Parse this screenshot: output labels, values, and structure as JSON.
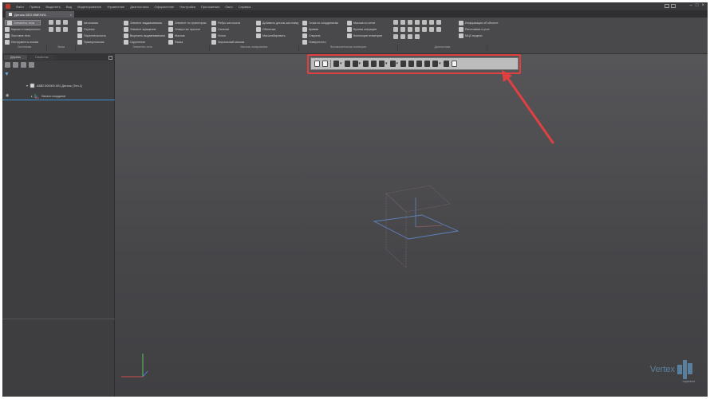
{
  "menu": {
    "items": [
      "Файл",
      "Правка",
      "Выделить",
      "Вид",
      "Моделирование",
      "Управление",
      "Диагностика",
      "Оформление",
      "Настройка",
      "Приложения",
      "Окно",
      "Справка"
    ]
  },
  "tabs": {
    "active_label": "Деталь БЕЗ ИМЕНИ1",
    "close": "×"
  },
  "window_controls": {
    "minimize": "–",
    "maximize": "□",
    "close": "×"
  },
  "ribbon": {
    "col1": [
      "Элементы тела",
      "Каркас и поверхности",
      "Листовое тело",
      "Инструменты эскиза"
    ],
    "col3": [
      "Автолиния",
      "Отрезок",
      "Параллельность",
      "Прямоугольник"
    ],
    "col4": [
      "Элемент выдавливания",
      "Элемент вращения",
      "Вырезать выдавливанием",
      "Скругление"
    ],
    "col5": [
      "Элемент по траектории",
      "Отверстие простое",
      "Массив",
      "Фаска"
    ],
    "col6": [
      "Ребро жесткости",
      "Сечение",
      "Уклон",
      "Зеркальный массив"
    ],
    "col7": [
      "Добавить деталь-заготовку",
      "Оболочка",
      "Масштабировать"
    ],
    "col8": [
      "Точка по координатам",
      "Кривая",
      "Спираль",
      "Поверхность"
    ],
    "col9": [
      "Массив по сетке",
      "Булева операция",
      "Коллекция геометрии"
    ],
    "col11": [
      "Информация об объекте",
      "Расстояние и угол",
      "МЦХ модели"
    ],
    "groups": [
      "Системная",
      "Эскиз",
      "Элементы тела",
      "Массив, копирование",
      "Вспомогательная геометрия",
      "Диагностика"
    ]
  },
  "panel": {
    "tab_tree": "Дерево",
    "tab_props": "Свойства",
    "root_label": "АБВГ.000000.001 Деталь (Тел-1)",
    "child_label": "Начало координат"
  },
  "brand": {
    "name": "Vertex",
    "sub": "подписка"
  },
  "colors": {
    "highlight": "#e04040",
    "arrow": "#e04040",
    "brand": "#6fb3e6",
    "tree_accent": "#3d8fd0"
  }
}
